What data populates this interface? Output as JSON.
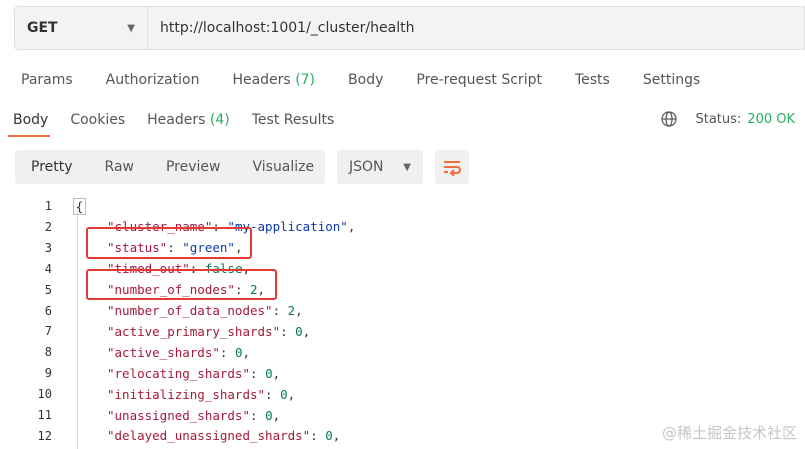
{
  "request": {
    "method": "GET",
    "url": "http://localhost:1001/_cluster/health"
  },
  "request_tabs": [
    {
      "label": "Params",
      "count": ""
    },
    {
      "label": "Authorization",
      "count": ""
    },
    {
      "label": "Headers",
      "count": "(7)"
    },
    {
      "label": "Body",
      "count": ""
    },
    {
      "label": "Pre-request Script",
      "count": ""
    },
    {
      "label": "Tests",
      "count": ""
    },
    {
      "label": "Settings",
      "count": ""
    }
  ],
  "response_tabs": [
    {
      "label": "Body",
      "count": ""
    },
    {
      "label": "Cookies",
      "count": ""
    },
    {
      "label": "Headers",
      "count": "(4)"
    },
    {
      "label": "Test Results",
      "count": ""
    }
  ],
  "response": {
    "status_label": "Status:",
    "status_value": "200 OK"
  },
  "view_modes": [
    "Pretty",
    "Raw",
    "Preview",
    "Visualize"
  ],
  "format": "JSON",
  "icons": {
    "method_caret": "chevron-down-icon",
    "format_caret": "chevron-down-icon",
    "globe": "globe-icon",
    "wrap": "wrap-lines-icon"
  },
  "colors": {
    "accent": "#f26b3a",
    "status_ok": "#27ae60",
    "highlight": "#e53935"
  },
  "code": {
    "lines": [
      {
        "n": "1",
        "key": "",
        "value": "",
        "type": "open"
      },
      {
        "n": "2",
        "key": "\"cluster_name\"",
        "value": "\"my-application\"",
        "type": "str"
      },
      {
        "n": "3",
        "key": "\"status\"",
        "value": "\"green\"",
        "type": "str"
      },
      {
        "n": "4",
        "key": "\"timed_out\"",
        "value": "false",
        "type": "num"
      },
      {
        "n": "5",
        "key": "\"number_of_nodes\"",
        "value": "2",
        "type": "num"
      },
      {
        "n": "6",
        "key": "\"number_of_data_nodes\"",
        "value": "2",
        "type": "num"
      },
      {
        "n": "7",
        "key": "\"active_primary_shards\"",
        "value": "0",
        "type": "num"
      },
      {
        "n": "8",
        "key": "\"active_shards\"",
        "value": "0",
        "type": "num"
      },
      {
        "n": "9",
        "key": "\"relocating_shards\"",
        "value": "0",
        "type": "num"
      },
      {
        "n": "10",
        "key": "\"initializing_shards\"",
        "value": "0",
        "type": "num"
      },
      {
        "n": "11",
        "key": "\"unassigned_shards\"",
        "value": "0",
        "type": "num"
      },
      {
        "n": "12",
        "key": "\"delayed_unassigned_shards\"",
        "value": "0",
        "type": "num"
      }
    ],
    "open_brace": "{"
  },
  "watermark": "@稀土掘金技术社区"
}
